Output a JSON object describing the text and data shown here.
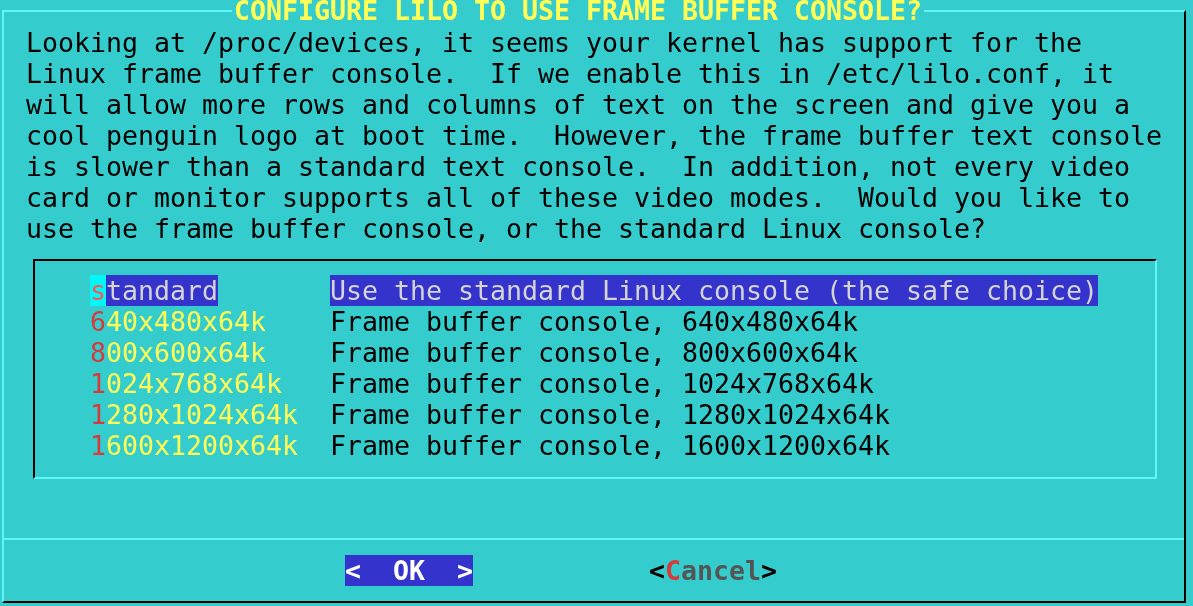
{
  "dialog": {
    "title": "CONFIGURE LILO TO USE FRAME BUFFER CONSOLE?",
    "message": [
      "Looking at /proc/devices, it seems your kernel has support for the",
      "Linux frame buffer console.  If we enable this in /etc/lilo.conf, it",
      "will allow more rows and columns of text on the screen and give you a",
      "cool penguin logo at boot time.  However, the frame buffer text console",
      "is slower than a standard text console.  In addition, not every video",
      "card or monitor supports all of these video modes.  Would you like to",
      "use the frame buffer console, or the standard Linux console?"
    ]
  },
  "menu": {
    "items": [
      {
        "tag": "standard",
        "description": "Use the standard Linux console (the safe choice)",
        "selected": true
      },
      {
        "tag": "640x480x64k",
        "description": "Frame buffer console, 640x480x64k",
        "selected": false
      },
      {
        "tag": "800x600x64k",
        "description": "Frame buffer console, 800x600x64k",
        "selected": false
      },
      {
        "tag": "1024x768x64k",
        "description": "Frame buffer console, 1024x768x64k",
        "selected": false
      },
      {
        "tag": "1280x1024x64k",
        "description": "Frame buffer console, 1280x1024x64k",
        "selected": false
      },
      {
        "tag": "1600x1200x64k",
        "description": "Frame buffer console, 1600x1200x64k",
        "selected": false
      }
    ]
  },
  "buttons": [
    {
      "open": "<",
      "label": "OK",
      "close": ">",
      "selected": true
    },
    {
      "open": "<",
      "label": "Cancel",
      "close": ">",
      "selected": false
    }
  ]
}
